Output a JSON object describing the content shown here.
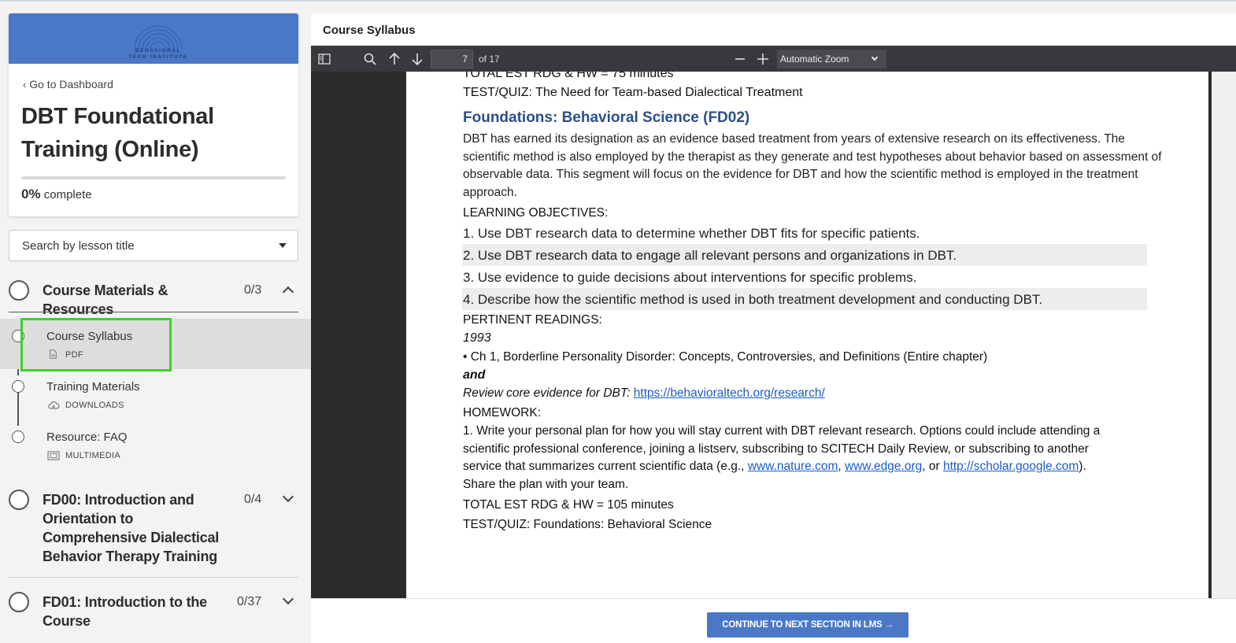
{
  "sidebar": {
    "logo_text_line1": "BEHAVIORAL",
    "logo_text_line2": "TECH INSTITUTE",
    "back_link": "Go to Dashboard",
    "course_title": "DBT Foundational Training (Online)",
    "progress_percent": "0%",
    "progress_label": "complete",
    "progress_value": 0,
    "search_placeholder": "Search by lesson title",
    "sections": [
      {
        "title": "Course Materials & Resources",
        "count": "0/3",
        "expanded": true,
        "lessons": [
          {
            "title": "Course Syllabus",
            "type": "PDF",
            "icon": "pdf-icon",
            "active": true
          },
          {
            "title": "Training Materials",
            "type": "DOWNLOADS",
            "icon": "cloud-download-icon",
            "active": false
          },
          {
            "title": "Resource: FAQ",
            "type": "MULTIMEDIA",
            "icon": "multimedia-icon",
            "active": false
          }
        ]
      },
      {
        "title": "FD00: Introduction and Orientation to Comprehensive Dialectical Behavior Therapy Training",
        "count": "0/4",
        "expanded": false
      },
      {
        "title": "FD01: Introduction to the Course",
        "count": "0/37",
        "expanded": false
      }
    ]
  },
  "viewer": {
    "title": "Course Syllabus",
    "toolbar": {
      "page_number": "7",
      "page_of": "of 17",
      "zoom": "Automatic Zoom"
    },
    "page": {
      "top_cut_line": "TOTAL EST RDG & HW = 75 minutes",
      "prev_quiz": "TEST/QUIZ: The Need for Team-based Dialectical Treatment",
      "heading": "Foundations: Behavioral Science (FD02)",
      "description": "DBT has earned its designation as an evidence based treatment from years of extensive research on its effectiveness. The scientific method is also employed by the therapist as they generate and test hypotheses about behavior based on assessment of observable data. This segment will focus on the evidence for DBT and how the scientific method is employed in the treatment approach.",
      "objectives_label": "LEARNING OBJECTIVES:",
      "objectives": [
        "1. Use DBT research data to determine whether DBT fits for specific patients.",
        "2. Use DBT research data to engage all relevant persons and organizations in DBT.",
        "3. Use evidence to guide decisions about interventions for specific problems.",
        "4. Describe how the scientific method is used in both treatment development and conducting DBT."
      ],
      "readings_label": "PERTINENT READINGS:",
      "reading_year": "1993",
      "reading_item": "• Ch 1, Borderline Personality Disorder: Concepts, Controversies, and Definitions (Entire chapter)",
      "reading_and": "and",
      "review_text": "Review core evidence for DBT: ",
      "review_link": "https://behavioraltech.org/research/",
      "homework_label": "HOMEWORK:",
      "homework_line1": "1. Write your personal plan for how you will stay current with DBT relevant research. Options could include attending a",
      "homework_line2": "scientific professional conference, joining a listserv, subscribing to SCITECH Daily Review, or subscribing to another",
      "homework_line3_pre": "service that summarizes current scientific data (e.g., ",
      "homework_link1": "www.nature.com",
      "homework_sep1": ", ",
      "homework_link2": "www.edge.org",
      "homework_sep2": ", or ",
      "homework_link3": "http://scholar.google.com",
      "homework_line3_post": ").",
      "homework_line4": "Share the plan with your team.",
      "total": "TOTAL EST RDG & HW = 105 minutes",
      "quiz": "TEST/QUIZ: Foundations: Behavioral Science"
    },
    "continue_button": "CONTINUE TO NEXT SECTION IN LMS"
  },
  "colors": {
    "brand_blue": "#4a78c6",
    "heading_blue": "#2a4f8c",
    "highlight_green": "#3ad22a",
    "toolbar_dark": "#38383d"
  }
}
